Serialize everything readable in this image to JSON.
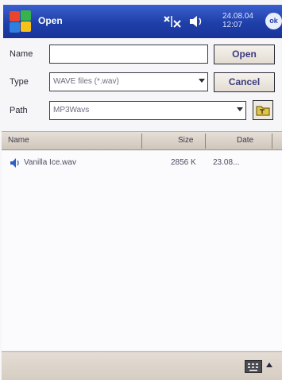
{
  "window": {
    "title": "Open",
    "date": "24.08.04",
    "time": "12:07",
    "ok_label": "ok",
    "start_icon": "windows-flag-icon",
    "signal_icon": "connectivity-icon",
    "volume_icon": "speaker-icon"
  },
  "form": {
    "name_label": "Name",
    "name_value": "",
    "type_label": "Type",
    "type_value": "WAVE files (*.wav)",
    "path_label": "Path",
    "path_value": "MP3Wavs",
    "open_label": "Open",
    "cancel_label": "Cancel",
    "folder_icon": "folder-up-icon"
  },
  "list": {
    "columns": [
      "Name",
      "Size",
      "Date"
    ],
    "rows": [
      {
        "name": "Vanilla Ice.wav",
        "size": "2856 K",
        "date": "23.08...",
        "icon": "audio-file-icon"
      }
    ]
  },
  "menubar": {
    "keyboard_icon": "keyboard-icon",
    "sip_arrow_icon": "sip-arrow-icon"
  },
  "colors": {
    "titlebar": "#1f3fa8",
    "button_text": "#3b3b80",
    "header_bg": "#cfc6bb"
  }
}
